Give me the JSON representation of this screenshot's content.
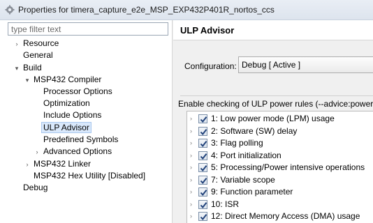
{
  "window": {
    "title": "Properties for timera_capture_e2e_MSP_EXP432P401R_nortos_ccs"
  },
  "filter": {
    "placeholder": "type filter text"
  },
  "tree": [
    {
      "label": "Resource",
      "twisty": "›",
      "selected": false
    },
    {
      "label": "General",
      "twisty": "",
      "selected": false
    },
    {
      "label": "Build",
      "twisty": "▾",
      "selected": false
    },
    {
      "label": "MSP432 Compiler",
      "twisty": "▾",
      "selected": false
    },
    {
      "label": "Processor Options",
      "twisty": "",
      "selected": false
    },
    {
      "label": "Optimization",
      "twisty": "",
      "selected": false
    },
    {
      "label": "Include Options",
      "twisty": "",
      "selected": false
    },
    {
      "label": "ULP Advisor",
      "twisty": "",
      "selected": true
    },
    {
      "label": "Predefined Symbols",
      "twisty": "",
      "selected": false
    },
    {
      "label": "Advanced Options",
      "twisty": "›",
      "selected": false
    },
    {
      "label": "MSP432 Linker",
      "twisty": "›",
      "selected": false
    },
    {
      "label": "MSP432 Hex Utility  [Disabled]",
      "twisty": "",
      "selected": false
    },
    {
      "label": "Debug",
      "twisty": "",
      "selected": false
    }
  ],
  "page": {
    "title": "ULP Advisor"
  },
  "configuration": {
    "label": "Configuration:",
    "value": "Debug  [ Active ]"
  },
  "rules_group": {
    "label": "Enable checking of ULP power rules (--advice:power)",
    "rules": [
      {
        "label": "1: Low power mode (LPM) usage",
        "checked": true
      },
      {
        "label": "2: Software (SW) delay",
        "checked": true
      },
      {
        "label": "3: Flag polling",
        "checked": true
      },
      {
        "label": "4: Port initialization",
        "checked": true
      },
      {
        "label": "5: Processing/Power intensive operations",
        "checked": true
      },
      {
        "label": "7: Variable scope",
        "checked": true
      },
      {
        "label": "9: Function parameter",
        "checked": true
      },
      {
        "label": "10: ISR",
        "checked": true
      },
      {
        "label": "12: Direct Memory Access (DMA) usage",
        "checked": true
      }
    ]
  }
}
